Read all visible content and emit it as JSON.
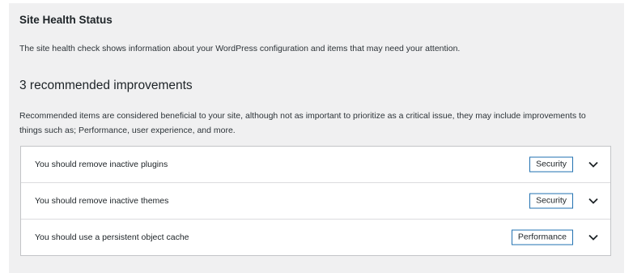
{
  "site_health": {
    "title": "Site Health Status",
    "description": "The site health check shows information about your WordPress configuration and items that may need your attention."
  },
  "recommended": {
    "heading": "3 recommended improvements",
    "description": "Recommended items are considered beneficial to your site, although not as important to prioritize as a critical issue, they may include improvements to things such as; Performance, user experience, and more.",
    "items": [
      {
        "label": "You should remove inactive plugins",
        "badge": "Security",
        "icon": "chevron-down-icon"
      },
      {
        "label": "You should remove inactive themes",
        "badge": "Security",
        "icon": "chevron-down-icon"
      },
      {
        "label": "You should use a persistent object cache",
        "badge": "Performance",
        "icon": "chevron-down-icon"
      }
    ]
  },
  "colors": {
    "panel_background": "#f0f0f1",
    "badge_border": "#2271b1",
    "text": "#1d2327"
  }
}
